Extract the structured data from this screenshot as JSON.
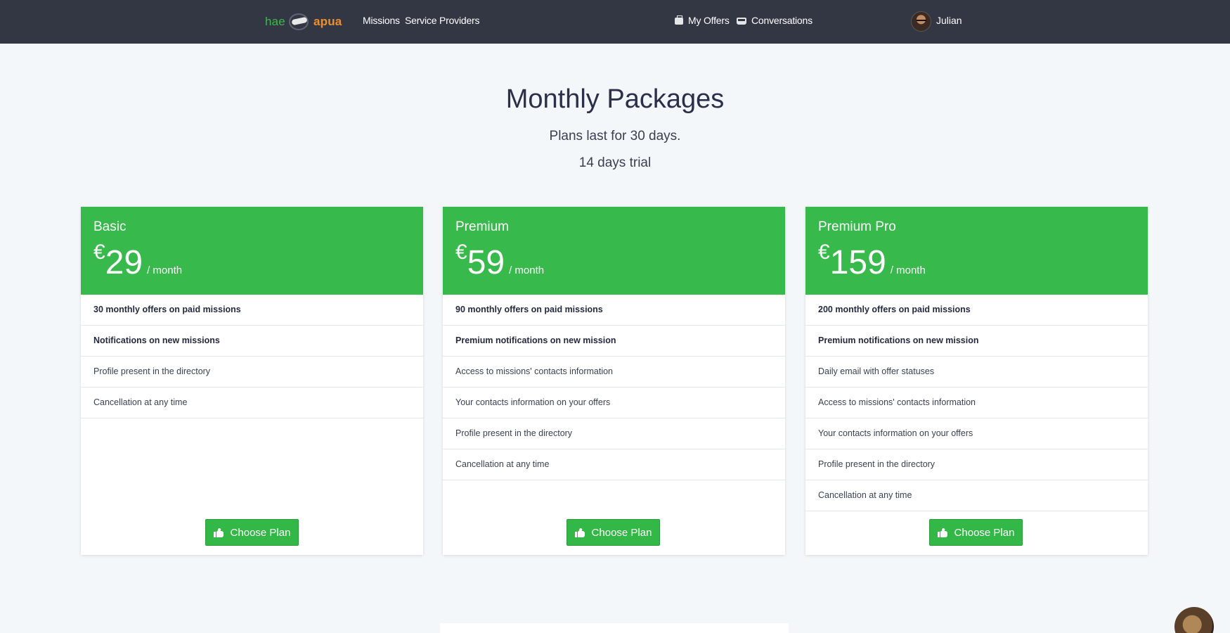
{
  "nav": {
    "logo_part1": "hae",
    "logo_part2": "apua",
    "links": [
      {
        "label": "Missions"
      },
      {
        "label": "Service Providers"
      }
    ],
    "my_offers": {
      "label": "My Offers",
      "icon": "briefcase-icon"
    },
    "conversations": {
      "label": "Conversations",
      "icon": "inbox-icon"
    },
    "user": {
      "name": "Julian"
    }
  },
  "header": {
    "title": "Monthly Packages",
    "subtitle1": "Plans last for 30 days.",
    "subtitle2": "14 days trial"
  },
  "plans": [
    {
      "name": "Basic",
      "currency": "€",
      "price": "29",
      "period": "/ month",
      "features": [
        "30 monthly offers on paid missions",
        "Notifications on new missions",
        "Profile present in the directory",
        "Cancellation at any time"
      ],
      "button": "Choose Plan"
    },
    {
      "name": "Premium",
      "currency": "€",
      "price": "59",
      "period": "/ month",
      "features": [
        "90 monthly offers on paid missions",
        "Premium notifications on new mission",
        "Access to missions' contacts information",
        "Your contacts information on your offers",
        "Profile present in the directory",
        "Cancellation at any time"
      ],
      "button": "Choose Plan"
    },
    {
      "name": "Premium Pro",
      "currency": "€",
      "price": "159",
      "period": "/ month",
      "features": [
        "200 monthly offers on paid missions",
        "Premium notifications on new mission",
        "Daily email with offer statuses",
        "Access to missions' contacts information",
        "Your contacts information on your offers",
        "Profile present in the directory",
        "Cancellation at any time"
      ],
      "button": "Choose Plan"
    }
  ],
  "colors": {
    "navbar": "#333744",
    "accent_green": "#37ba4b",
    "logo_green": "#3cb84a",
    "logo_orange": "#ef8e2a",
    "background": "#f4f7fa"
  }
}
